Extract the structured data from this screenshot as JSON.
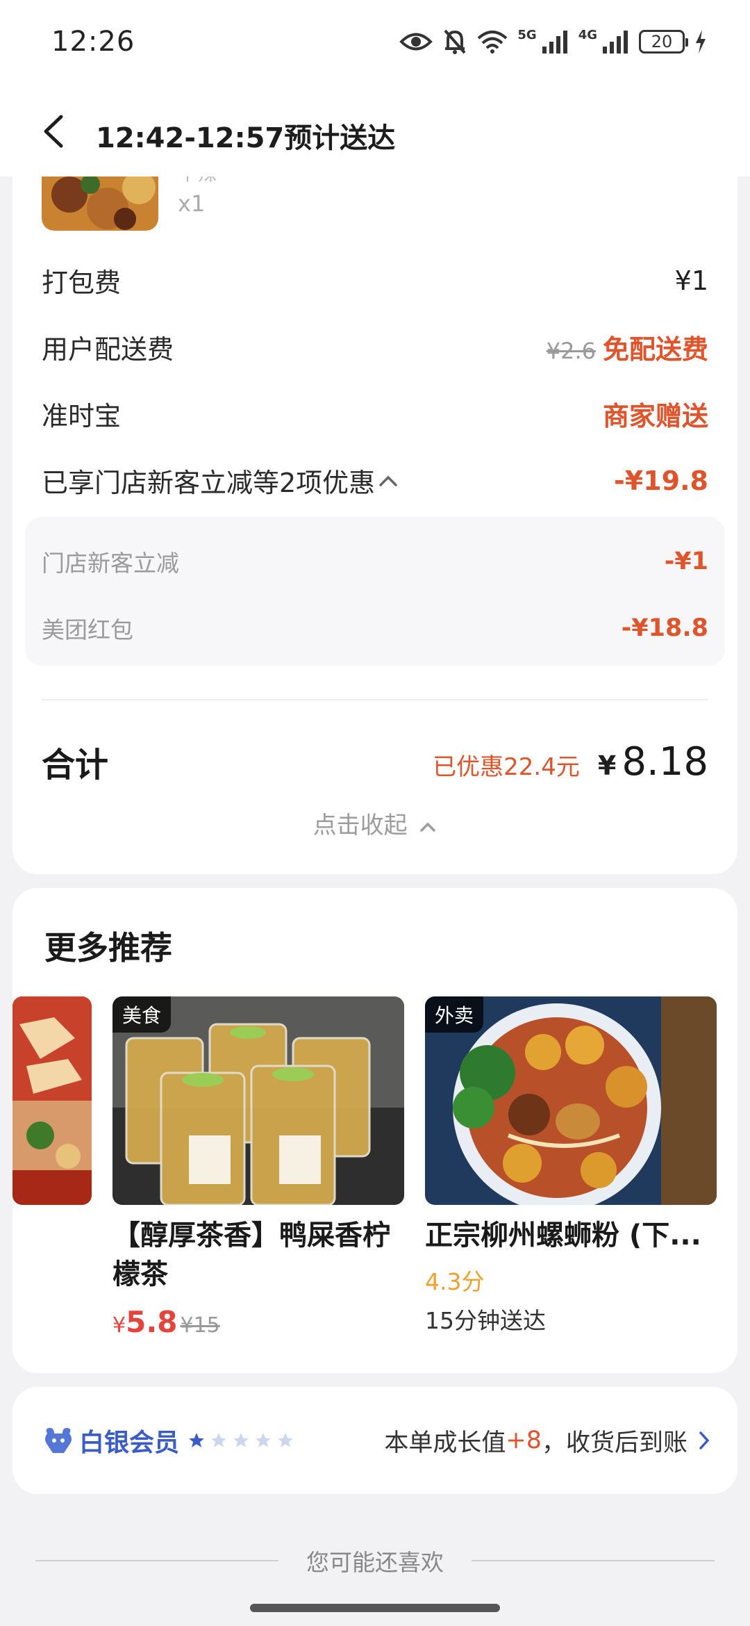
{
  "status_bar": {
    "time": "12:26",
    "net_5g": "5G",
    "net_4g": "4G",
    "battery": "20",
    "icons": [
      "eye-icon",
      "mute-bell-icon",
      "wifi-icon",
      "signal-icon",
      "charging-icon"
    ]
  },
  "header": {
    "title": "12:42-12:57预计送达"
  },
  "order": {
    "item_qty": "x1",
    "item_spec_partial": "中辣",
    "packing_fee_label": "打包费",
    "packing_fee_value": "¥1",
    "delivery_fee_label": "用户配送费",
    "delivery_fee_original": "¥2.6",
    "delivery_fee_value": "免配送费",
    "ontime_label": "准时宝",
    "ontime_value": "商家赠送",
    "discount_summary_label": "已享门店新客立减等2项优惠",
    "discount_summary_value": "-¥19.8",
    "discounts": [
      {
        "label": "门店新客立减",
        "value": "-¥1"
      },
      {
        "label": "美团红包",
        "value": "-¥18.8"
      }
    ],
    "total_label": "合计",
    "saved_text": "已优惠22.4元",
    "total_currency": "¥",
    "total_value": "8.18",
    "collapse_text": "点击收起"
  },
  "recommend": {
    "title": "更多推荐",
    "items": [
      {
        "tag": "美食",
        "name": "【醇厚茶香】鸭屎香柠檬茶",
        "price_currency": "¥",
        "price": "5.8",
        "original_price": "¥15"
      },
      {
        "tag": "外卖",
        "name": "正宗柳州螺蛳粉 (下...",
        "rating": "4.3分",
        "eta": "15分钟送达"
      }
    ]
  },
  "member": {
    "level": "白银会员",
    "stars_filled": 1,
    "stars_total": 5,
    "growth_prefix": "本单成长值",
    "growth_value": "+8",
    "growth_suffix": "，收货后到账"
  },
  "footer": {
    "maybe_like": "您可能还喜欢"
  },
  "colors": {
    "accent_red": "#e0542c",
    "member_blue": "#3a5cc9",
    "rating_orange": "#f0a02b"
  }
}
